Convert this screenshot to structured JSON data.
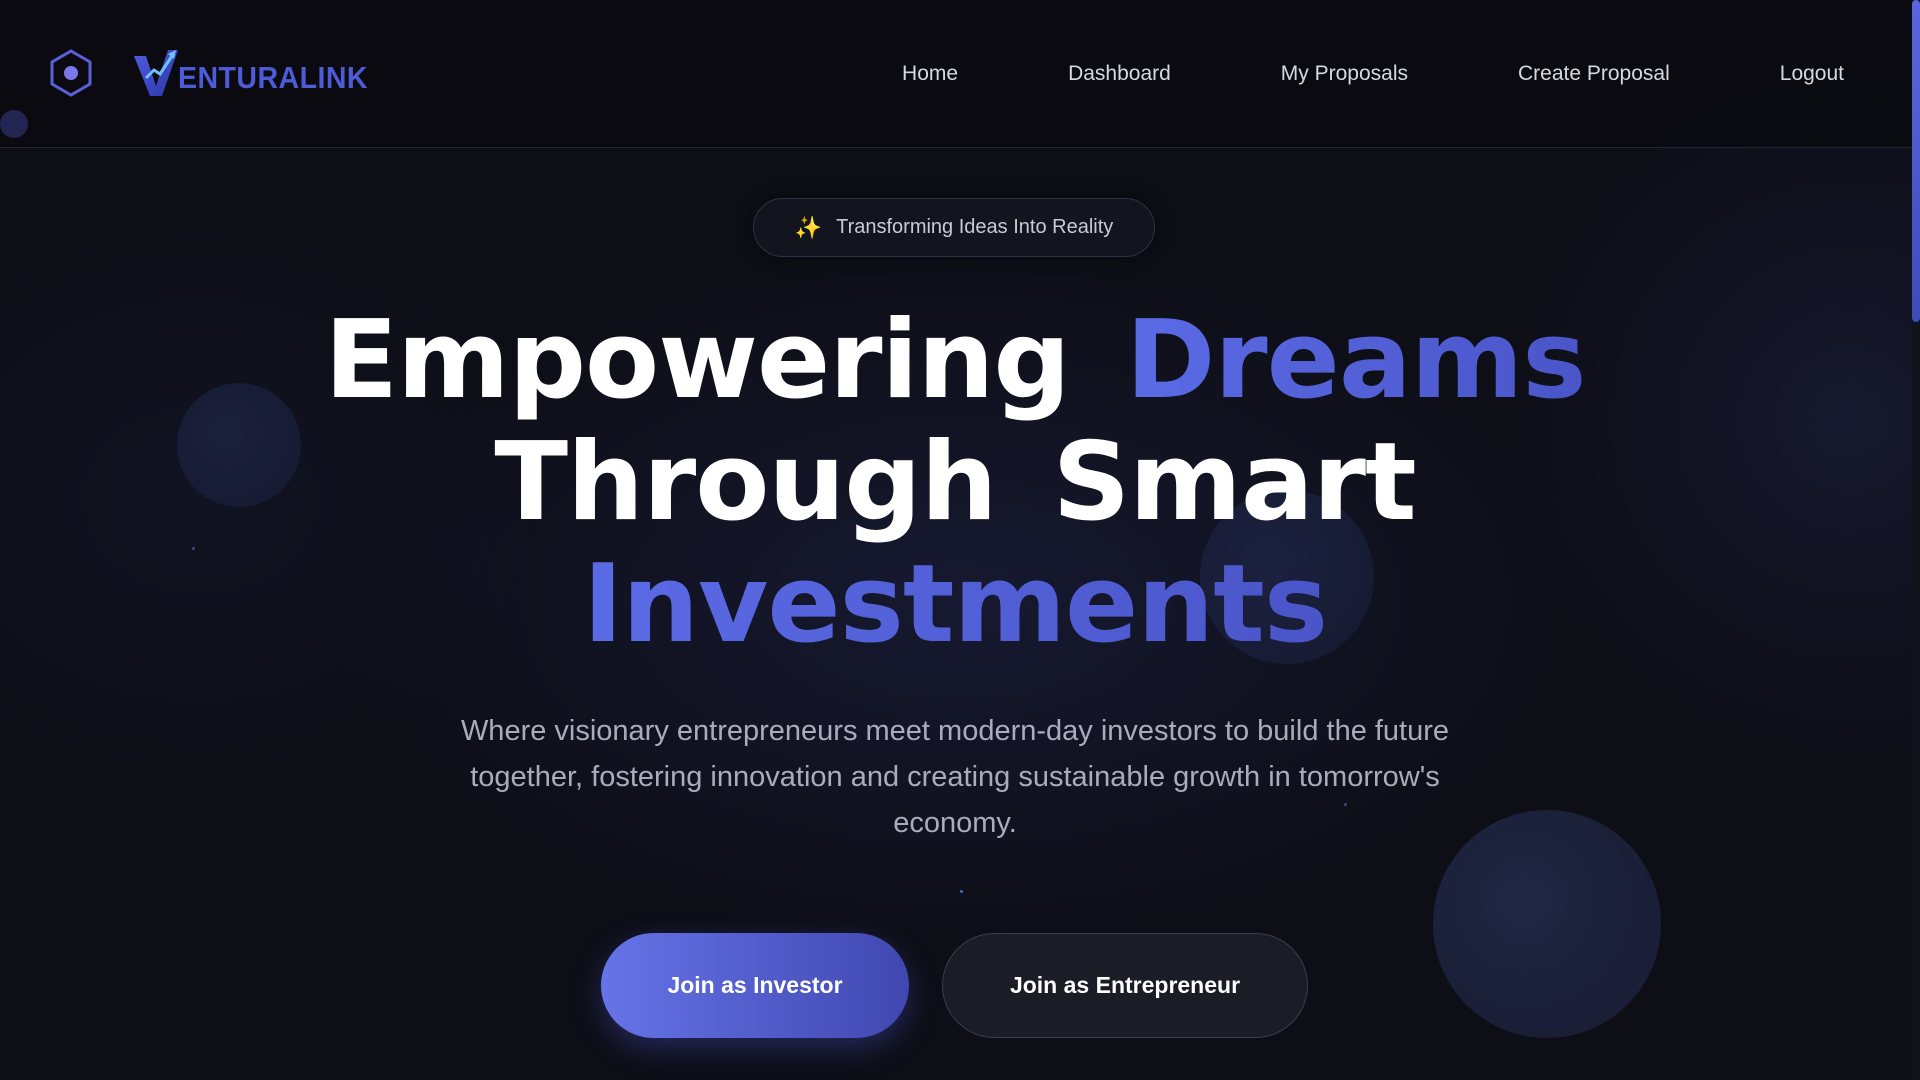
{
  "brand": {
    "logo_letter": "V",
    "logo_text": "ENTURALINK",
    "accent_color": "#4e5bd6"
  },
  "nav": {
    "items": [
      {
        "label": "Home"
      },
      {
        "label": "Dashboard"
      },
      {
        "label": "My Proposals"
      },
      {
        "label": "Create Proposal"
      },
      {
        "label": "Logout"
      }
    ]
  },
  "hero": {
    "badge_icon": "sparkles-icon",
    "badge_text": "Transforming Ideas Into Reality",
    "headline": {
      "word_1": "Empowering",
      "word_2": "Dreams",
      "word_3": "Through",
      "word_4": "Smart",
      "word_5": "Investments"
    },
    "subtitle": "Where visionary entrepreneurs meet modern-day investors to build the future together, fostering innovation and creating sustainable growth in tomorrow's economy.",
    "cta_primary": "Join as Investor",
    "cta_secondary": "Join as Entrepreneur"
  },
  "colors": {
    "background": "#0d0e16",
    "highlight": "#5b6be6",
    "button_gradient_start": "#6674e8",
    "button_gradient_end": "#4047b0"
  }
}
